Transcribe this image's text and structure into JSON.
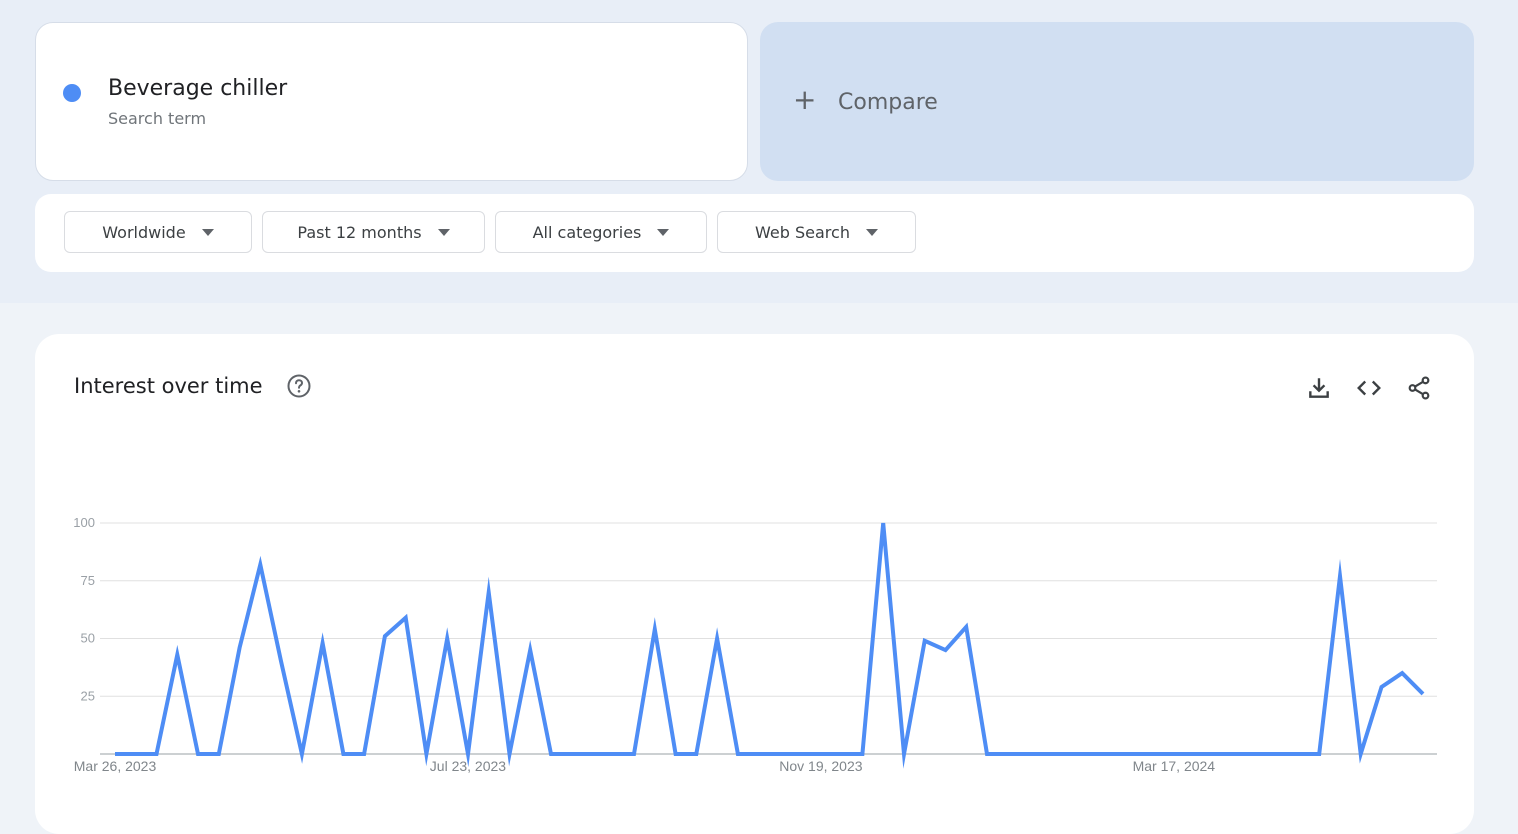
{
  "search_term": {
    "name": "Beverage chiller",
    "subtitle": "Search term",
    "color": "#4e8df5"
  },
  "compare": {
    "plus": "+",
    "label": "Compare"
  },
  "filters": {
    "region": "Worldwide",
    "time": "Past 12 months",
    "category": "All categories",
    "property": "Web Search"
  },
  "chart_panel": {
    "title": "Interest over time",
    "icons": [
      "help-icon",
      "download-icon",
      "embed-icon",
      "share-icon"
    ]
  },
  "chart_data": {
    "type": "line",
    "title": "Interest over time",
    "xlabel": "",
    "ylabel": "",
    "ylim": [
      0,
      100
    ],
    "yticks": [
      25,
      50,
      75,
      100
    ],
    "xtick_labels": [
      "Mar 26, 2023",
      "Jul 23, 2023",
      "Nov 19, 2023",
      "Mar 17, 2024"
    ],
    "grid": true,
    "series": [
      {
        "name": "Beverage chiller",
        "color": "#4e8df5",
        "values": [
          0,
          0,
          0,
          43,
          0,
          0,
          46,
          82,
          40,
          0,
          48,
          0,
          0,
          51,
          59,
          0,
          50,
          0,
          70,
          0,
          45,
          0,
          0,
          0,
          0,
          0,
          54,
          0,
          0,
          50,
          0,
          0,
          0,
          0,
          0,
          0,
          0,
          100,
          0,
          49,
          45,
          55,
          0,
          0,
          0,
          0,
          0,
          0,
          0,
          0,
          0,
          0,
          0,
          0,
          0,
          0,
          0,
          0,
          0,
          77,
          0,
          29,
          35,
          26
        ]
      }
    ]
  }
}
